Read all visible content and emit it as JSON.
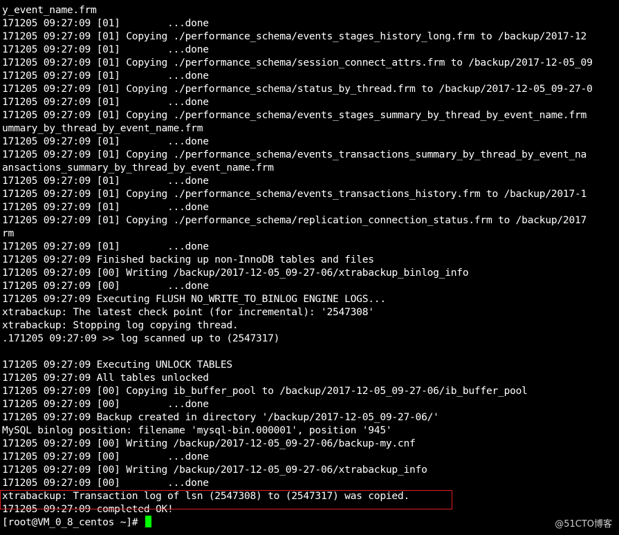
{
  "terminal": {
    "lines": [
      "y_event_name.frm",
      "171205 09:27:09 [01]        ...done",
      "171205 09:27:09 [01] Copying ./performance_schema/events_stages_history_long.frm to /backup/2017-12",
      "171205 09:27:09 [01]        ...done",
      "171205 09:27:09 [01] Copying ./performance_schema/session_connect_attrs.frm to /backup/2017-12-05_09",
      "171205 09:27:09 [01]        ...done",
      "171205 09:27:09 [01] Copying ./performance_schema/status_by_thread.frm to /backup/2017-12-05_09-27-0",
      "171205 09:27:09 [01]        ...done",
      "171205 09:27:09 [01] Copying ./performance_schema/events_stages_summary_by_thread_by_event_name.frm",
      "ummary_by_thread_by_event_name.frm",
      "171205 09:27:09 [01]        ...done",
      "171205 09:27:09 [01] Copying ./performance_schema/events_transactions_summary_by_thread_by_event_na",
      "ansactions_summary_by_thread_by_event_name.frm",
      "171205 09:27:09 [01]        ...done",
      "171205 09:27:09 [01] Copying ./performance_schema/events_transactions_history.frm to /backup/2017-1",
      "171205 09:27:09 [01]        ...done",
      "171205 09:27:09 [01] Copying ./performance_schema/replication_connection_status.frm to /backup/2017",
      "rm",
      "171205 09:27:09 [01]        ...done",
      "171205 09:27:09 Finished backing up non-InnoDB tables and files",
      "171205 09:27:09 [00] Writing /backup/2017-12-05_09-27-06/xtrabackup_binlog_info",
      "171205 09:27:09 [00]        ...done",
      "171205 09:27:09 Executing FLUSH NO_WRITE_TO_BINLOG ENGINE LOGS...",
      "xtrabackup: The latest check point (for incremental): '2547308'",
      "xtrabackup: Stopping log copying thread.",
      ".171205 09:27:09 >> log scanned up to (2547317)",
      "",
      "171205 09:27:09 Executing UNLOCK TABLES",
      "171205 09:27:09 All tables unlocked",
      "171205 09:27:09 [00] Copying ib_buffer_pool to /backup/2017-12-05_09-27-06/ib_buffer_pool",
      "171205 09:27:09 [00]        ...done",
      "171205 09:27:09 Backup created in directory '/backup/2017-12-05_09-27-06/'",
      "MySQL binlog position: filename 'mysql-bin.000001', position '945'",
      "171205 09:27:09 [00] Writing /backup/2017-12-05_09-27-06/backup-my.cnf",
      "171205 09:27:09 [00]        ...done",
      "171205 09:27:09 [00] Writing /backup/2017-12-05_09-27-06/xtrabackup_info",
      "171205 09:27:09 [00]        ...done",
      "xtrabackup: Transaction log of lsn (2547308) to (2547317) was copied.",
      "171205 09:27:09 completed OK!"
    ],
    "prompt": "[root@VM_0_8_centos ~]# ",
    "text_color": "#ffffff",
    "background_color": "#000000",
    "cursor_color": "#00ff00",
    "highlight_color": "#e02020"
  },
  "watermark": "@51CTO博客"
}
